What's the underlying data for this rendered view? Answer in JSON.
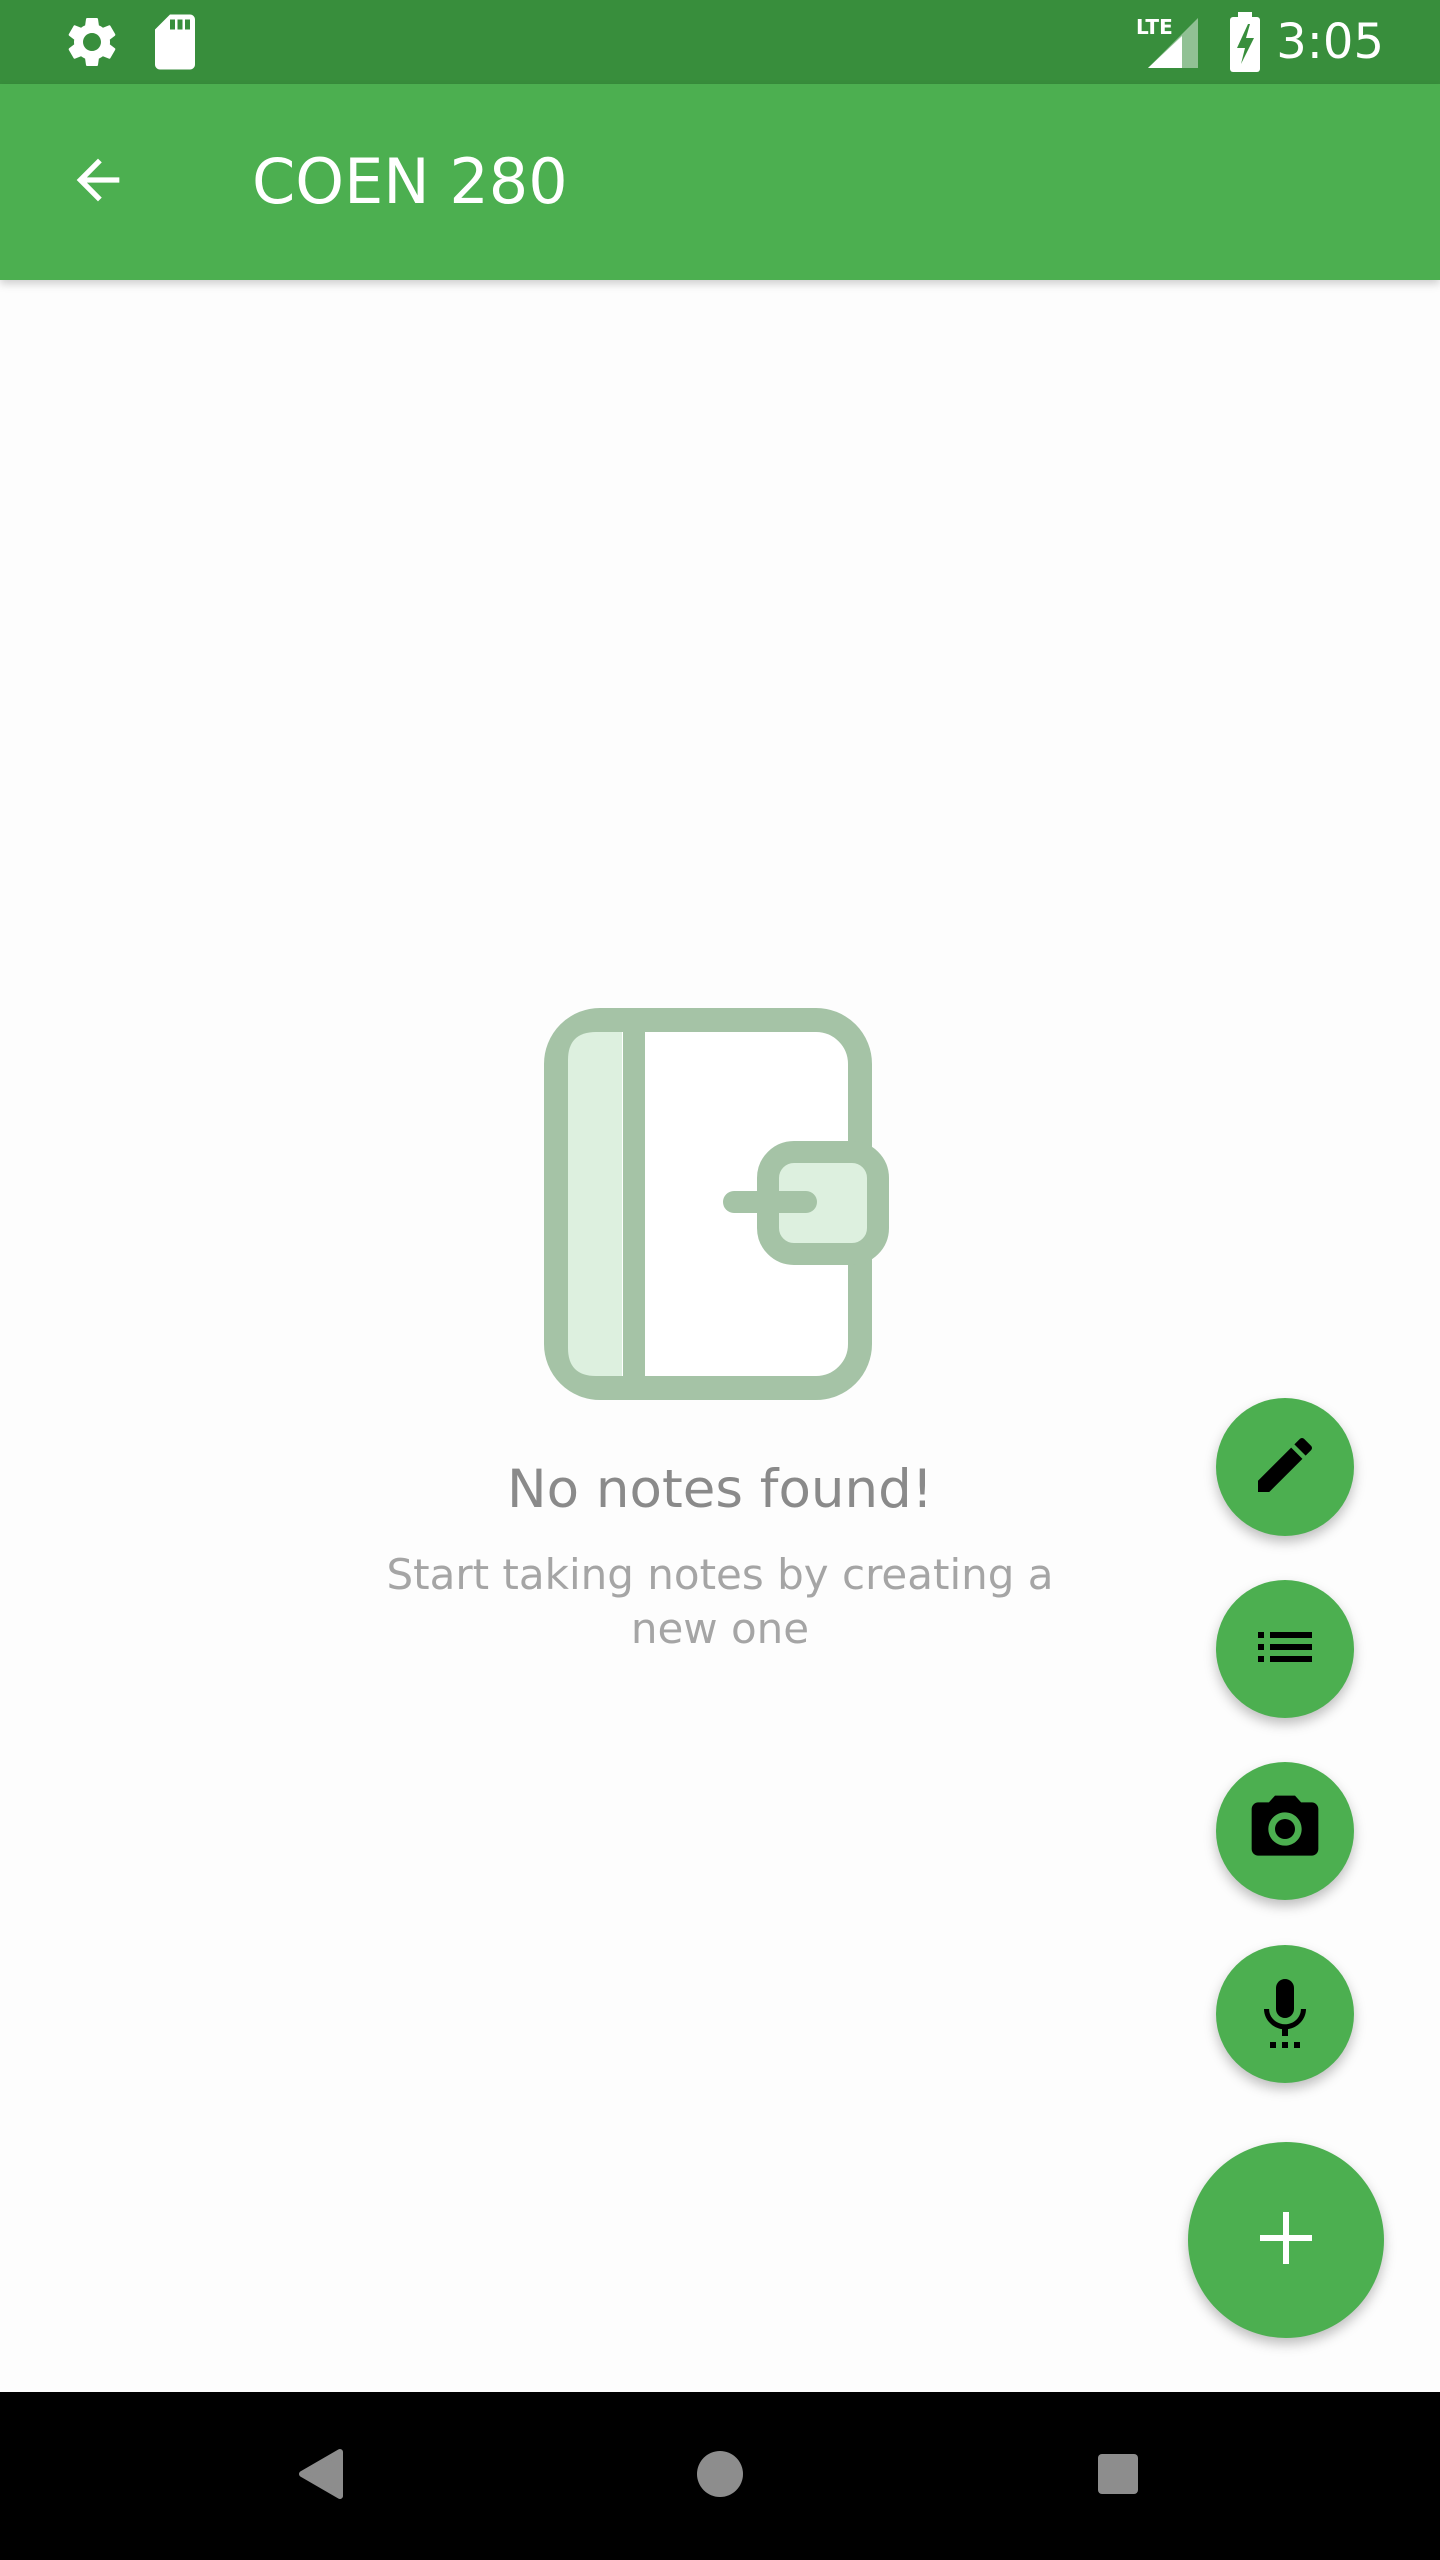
{
  "status_bar": {
    "time": "3:05",
    "network_label": "LTE",
    "icons": [
      "settings-icon",
      "sd-card-icon",
      "lte-signal-icon",
      "battery-charging-icon"
    ]
  },
  "app_bar": {
    "title": "COEN 280",
    "back_icon": "arrow-back-icon"
  },
  "empty_state": {
    "icon": "notebook-icon",
    "title": "No notes found!",
    "subtitle": "Start taking notes by creating a new one"
  },
  "fab_menu": {
    "actions": [
      {
        "icon": "pencil-icon",
        "name": "text-note"
      },
      {
        "icon": "checklist-icon",
        "name": "checklist-note"
      },
      {
        "icon": "camera-icon",
        "name": "photo-note"
      },
      {
        "icon": "microphone-icon",
        "name": "audio-note"
      }
    ],
    "main_icon": "plus-icon"
  },
  "nav_bar": {
    "buttons": [
      "back-triangle-icon",
      "home-circle-icon",
      "recents-square-icon"
    ]
  },
  "colors": {
    "status_bar": "#388e3c",
    "primary": "#4caf50",
    "illustration_stroke": "#a5c3a6",
    "illustration_fill": "#ddf0df",
    "title_text": "#8a8a8a",
    "subtitle_text": "#a5a5a5",
    "nav_bar": "#000000"
  }
}
